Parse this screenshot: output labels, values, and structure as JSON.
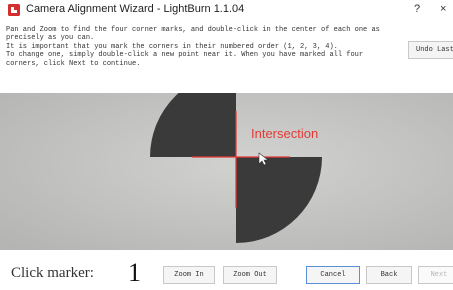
{
  "window": {
    "title": "Camera Alignment Wizard - LightBurn 1.1.04",
    "help_glyph": "?",
    "close_glyph": "×"
  },
  "instructions": [
    "Pan and Zoom to find the four corner marks, and double-click in the center of each one as",
    "precisely as you can.",
    "It is important that you mark the corners in their numbered order (1, 2, 3, 4).",
    "To change one, simply double-click a new point near it.  When you have marked all four",
    "corners, click Next to continue."
  ],
  "toolbar": {
    "undo_label": "Undo Last"
  },
  "camera_view": {
    "overlay_label": "Intersection",
    "crosshair_color": "#e53935"
  },
  "footer": {
    "click_marker_label": "Click marker:",
    "click_marker_value": "1",
    "zoom_in_label": "Zoom In",
    "zoom_out_label": "Zoom Out",
    "cancel_label": "Cancel",
    "back_label": "Back",
    "next_label": "Next"
  }
}
